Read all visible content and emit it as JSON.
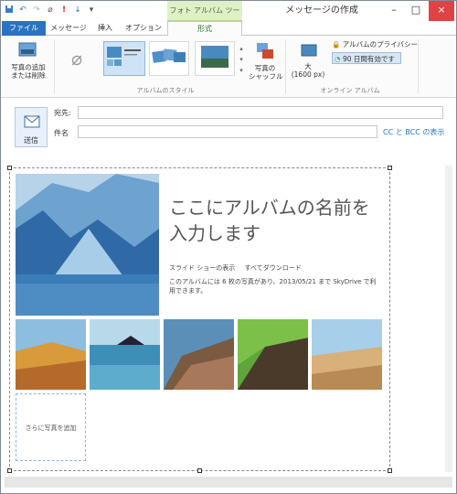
{
  "window": {
    "title": "メッセージの作成",
    "context_tab_group": "フォト アルバム ツール",
    "minimize": "–",
    "maximize": "□",
    "close": "×"
  },
  "qat": {
    "icons": [
      "save-icon",
      "undo-icon",
      "redo-icon",
      "attach-icon",
      "priority-high-icon",
      "priority-low-icon",
      "customize-icon"
    ]
  },
  "tabs": {
    "file": "ファイル",
    "message": "メッセージ",
    "insert": "挿入",
    "options": "オプション",
    "format": "形式"
  },
  "ribbon": {
    "add_remove_photos": "写真の追加\nまたは削除",
    "shuffle_photos": "写真の\nシャッフル",
    "size_label": "大\n(1600 px)",
    "privacy": "アルバムのプライバシー",
    "expiry": "90 日間有効です",
    "group_album_style": "アルバムのスタイル",
    "group_online_album": "オンライン アルバム"
  },
  "compose": {
    "send": "送信",
    "to_label": "宛先:",
    "subject_label": "件名",
    "cc_bcc": "CC と BCC の表示"
  },
  "album": {
    "title": "ここにアルバムの名前を入力します",
    "slideshow": "スライド ショーの表示",
    "download_all": "すべてダウンロード",
    "description": "このアルバムには 6 枚の写真があり、2013/05/21 まで SkyDrive で利用できます。",
    "add_photos": "さらに写真を追加"
  },
  "colors": {
    "accent": "#2b73c0",
    "context_tab": "#dff0c9",
    "close_button": "#e04343"
  }
}
